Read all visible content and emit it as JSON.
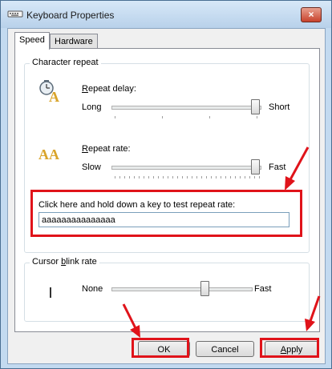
{
  "window": {
    "title": "Keyboard Properties",
    "close_glyph": "×",
    "icon": "keyboard-icon"
  },
  "tabs": [
    {
      "label": "Speed",
      "active": true
    },
    {
      "label": "Hardware",
      "active": false
    }
  ],
  "character_repeat": {
    "group_title": "Character repeat",
    "repeat_delay": {
      "label_prefix": "",
      "label_accel": "R",
      "label_rest": "epeat delay:",
      "min_label": "Long",
      "max_label": "Short",
      "level": 1.0,
      "icon": "repeat-delay-icon"
    },
    "repeat_rate": {
      "label_accel": "R",
      "label_rest": "epeat rate:",
      "min_label": "Slow",
      "max_label": "Fast",
      "level": 1.0,
      "icon": "repeat-rate-icon"
    },
    "test_prompt": "Click here and hold down a key to test repeat rate:",
    "test_value": "aaaaaaaaaaaaaaa"
  },
  "cursor_blink": {
    "group_title_pre": "Cursor ",
    "group_title_accel": "b",
    "group_title_rest": "link rate",
    "min_label": "None",
    "max_label": "Fast",
    "level": 0.65,
    "icon": "cursor-preview-icon"
  },
  "buttons": {
    "ok": "OK",
    "cancel": "Cancel",
    "apply_accel": "A",
    "apply_rest": "pply"
  },
  "annotation_color": "#e0131a"
}
